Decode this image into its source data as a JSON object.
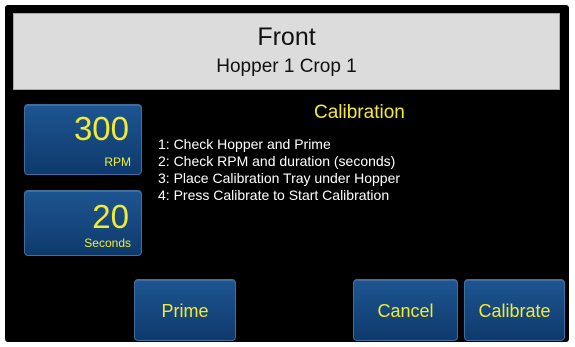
{
  "header": {
    "title": "Front",
    "subtitle": "Hopper 1 Crop 1"
  },
  "settings": {
    "rpm": {
      "value": "300",
      "unit": "RPM"
    },
    "duration": {
      "value": "20",
      "unit": "Seconds"
    }
  },
  "calibration": {
    "title": "Calibration",
    "steps": [
      "1: Check Hopper and Prime",
      "2: Check RPM and duration (seconds)",
      "3: Place Calibration Tray under Hopper",
      "4: Press Calibrate to Start Calibration"
    ]
  },
  "actions": {
    "prime": "Prime",
    "cancel": "Cancel",
    "calibrate": "Calibrate"
  },
  "colors": {
    "background": "#000000",
    "header_bg": "#dcdcdc",
    "button_bg": "#1d5591",
    "accent_text": "#f2ea34"
  }
}
